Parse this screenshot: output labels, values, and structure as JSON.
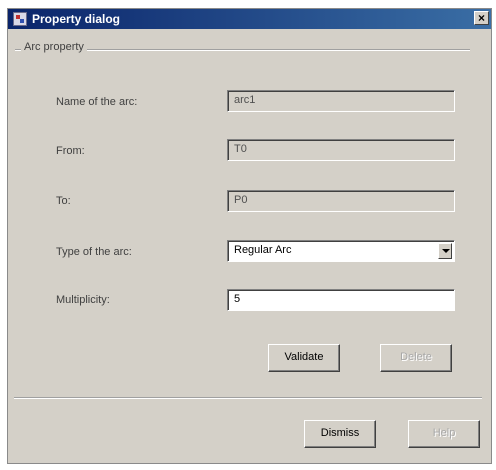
{
  "window": {
    "title": "Property dialog",
    "close_label": "×"
  },
  "group": {
    "legend": "Arc property"
  },
  "fields": {
    "name": {
      "label": "Name of the arc:",
      "value": "arc1"
    },
    "from": {
      "label": "From:",
      "value": "T0"
    },
    "to": {
      "label": "To:",
      "value": "P0"
    },
    "type": {
      "label": "Type of the arc:",
      "value": "Regular Arc"
    },
    "multiplicity": {
      "label": "Multiplicity:",
      "value": "5"
    }
  },
  "buttons": {
    "validate": "Validate",
    "delete": "Delete",
    "dismiss": "Dismiss",
    "help": "Help"
  },
  "colors": {
    "titlebar_start": "#0a246a",
    "titlebar_end": "#3a6ea5",
    "window_bg": "#d4d0c8"
  }
}
